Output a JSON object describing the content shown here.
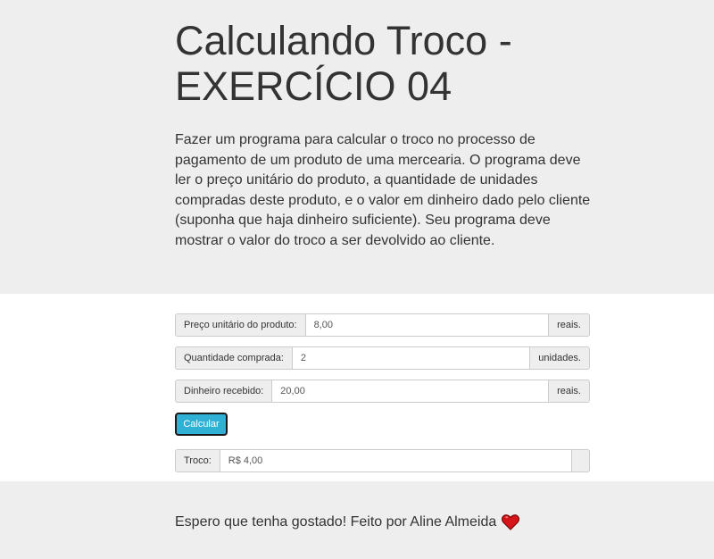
{
  "header": {
    "title_line1": "Calculando Troco -",
    "title_line2": "EXERCÍCIO 04",
    "description": "Fazer um programa para calcular o troco no processo de pagamento de um produto de uma mercearia. O programa deve ler o preço unitário do produto, a quantidade de unidades compradas deste produto, e o valor em dinheiro dado pelo cliente (suponha que haja dinheiro suficiente). Seu programa deve mostrar o valor do troco a ser devolvido ao cliente."
  },
  "form": {
    "price": {
      "label": "Preço unitário do produto:",
      "value": "8,00",
      "suffix": "reais."
    },
    "quantity": {
      "label": "Quantidade comprada:",
      "value": "2",
      "suffix": "unidades."
    },
    "cash": {
      "label": "Dinheiro recebido:",
      "value": "20,00",
      "suffix": "reais."
    },
    "calculate_label": "Calcular",
    "change": {
      "label": "Troco:",
      "value": "R$ 4,00"
    }
  },
  "footer": {
    "text": "Espero que tenha gostado! Feito por Aline Almeida",
    "heart_icon": "heart-icon",
    "heart_color": "#d7141a"
  }
}
